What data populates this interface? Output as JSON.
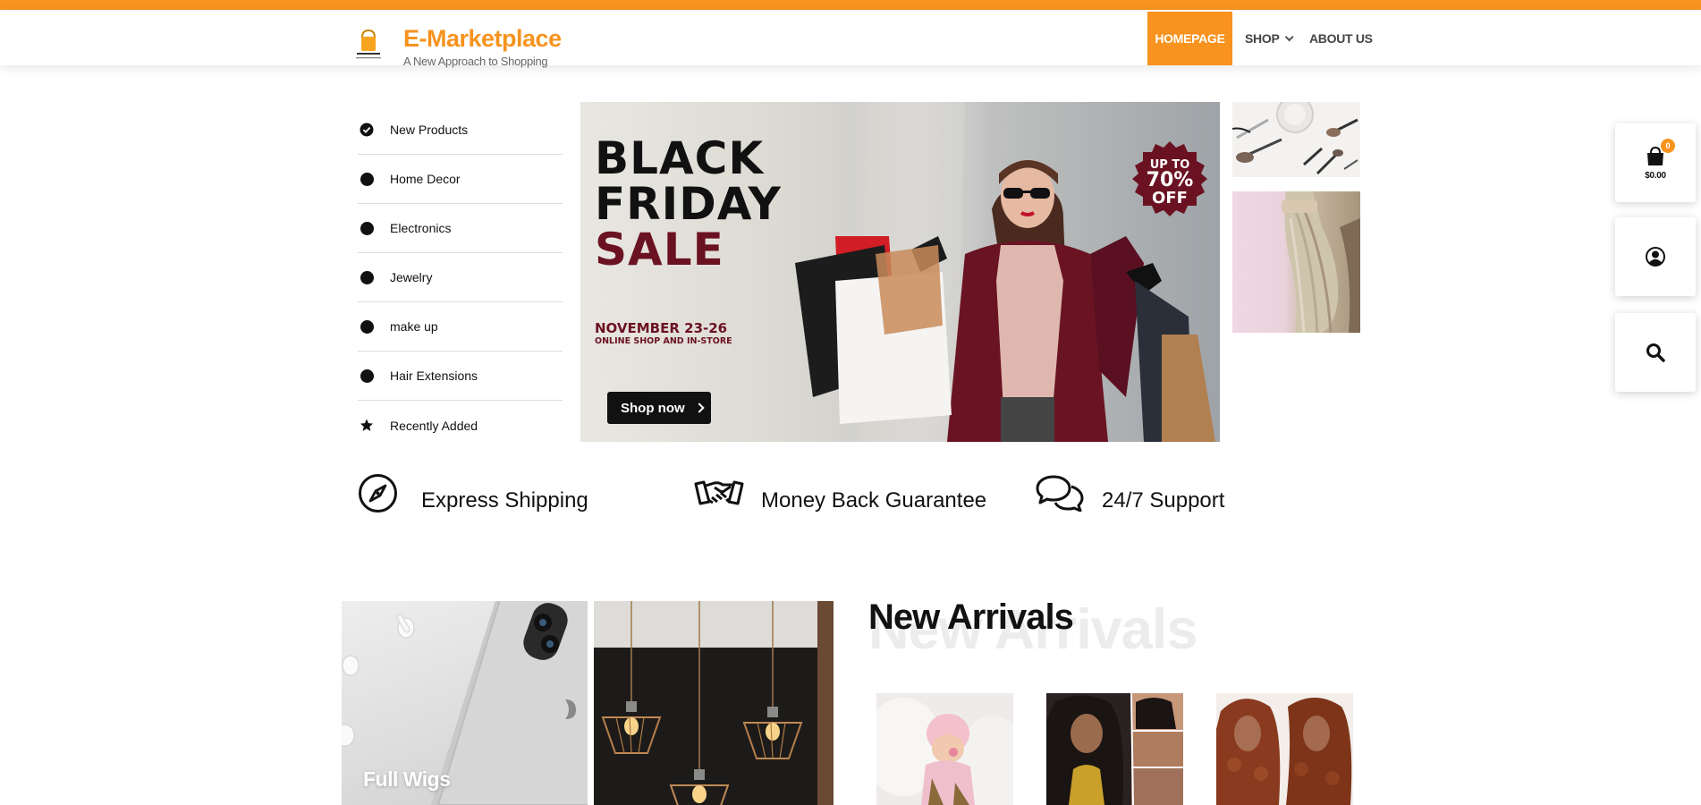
{
  "header": {
    "brand": "E-Marketplace",
    "tagline": "A New Approach to Shopping",
    "accent_color": "#f7931e",
    "logo_icon": "shopping-bag-logo"
  },
  "nav": {
    "items": [
      {
        "label": "HOMEPAGE",
        "active": true
      },
      {
        "label": "SHOP",
        "has_dropdown": true
      },
      {
        "label": "ABOUT US"
      }
    ]
  },
  "categories": [
    {
      "label": "New Products",
      "icon": "check-circle-icon"
    },
    {
      "label": "Home Decor",
      "icon": "dot-icon"
    },
    {
      "label": "Electronics",
      "icon": "dot-icon"
    },
    {
      "label": "Jewelry",
      "icon": "dot-icon"
    },
    {
      "label": "make up",
      "icon": "dot-icon"
    },
    {
      "label": "Hair Extensions",
      "icon": "dot-icon"
    },
    {
      "label": "Recently Added",
      "icon": "star-icon"
    }
  ],
  "hero": {
    "line1": "BLACK",
    "line2": "FRIDAY",
    "line3": "SALE",
    "date": "NOVEMBER 23-26",
    "sub": "ONLINE SHOP AND IN-STORE",
    "badge_line1": "UP TO",
    "badge_line2": "70%",
    "badge_line3": "OFF",
    "button": "Shop now"
  },
  "features": [
    {
      "label": "Express Shipping",
      "icon": "compass-icon"
    },
    {
      "label": "Money Back Guarantee",
      "icon": "handshake-icon"
    },
    {
      "label": "24/7 Support",
      "icon": "chat-bubbles-icon"
    }
  ],
  "promos": [
    {
      "title": "Full Wigs"
    }
  ],
  "new_arrivals": {
    "title": "New Arrivals",
    "ghost_title": "New Arrivals"
  },
  "floating": {
    "cart_count": "0",
    "cart_total": "$0.00"
  }
}
